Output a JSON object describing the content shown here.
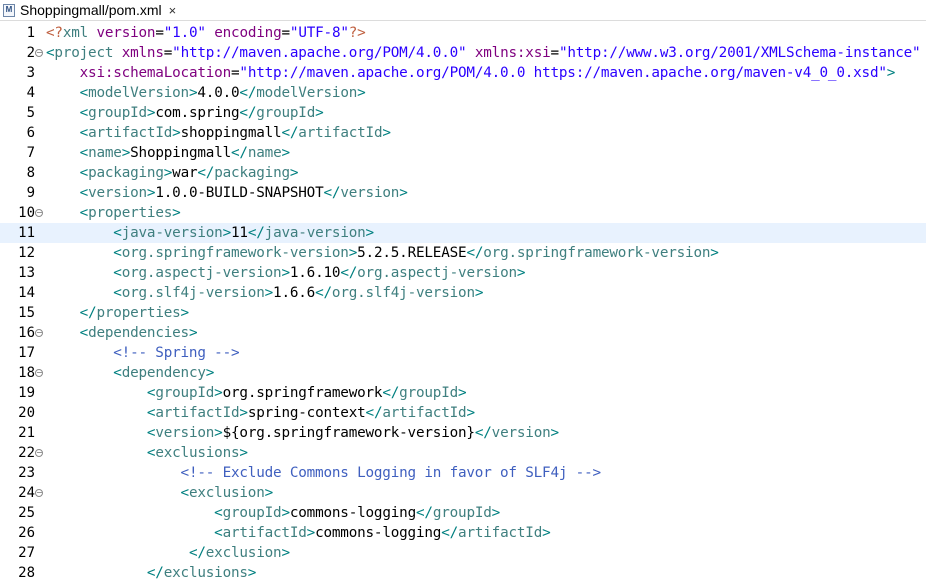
{
  "tab": {
    "title": "Shoppingmall/pom.xml",
    "icon": "M",
    "close": "×"
  },
  "editor": {
    "current_line": 11,
    "lines": [
      {
        "n": "1",
        "fold": false,
        "segs": [
          [
            "p",
            "<?"
          ],
          [
            "t",
            "xml "
          ],
          [
            "a",
            "version"
          ],
          [
            "x",
            "="
          ],
          [
            "v",
            "\"1.0\""
          ],
          [
            "x",
            " "
          ],
          [
            "a",
            "encoding"
          ],
          [
            "x",
            "="
          ],
          [
            "v",
            "\"UTF-8\""
          ],
          [
            "p",
            "?>"
          ]
        ]
      },
      {
        "n": "2",
        "fold": true,
        "segs": [
          [
            "b",
            "<"
          ],
          [
            "t",
            "project "
          ],
          [
            "a",
            "xmlns"
          ],
          [
            "x",
            "="
          ],
          [
            "v",
            "\"http://maven.apache.org/POM/4.0.0\""
          ],
          [
            "x",
            " "
          ],
          [
            "a",
            "xmlns:xsi"
          ],
          [
            "x",
            "="
          ],
          [
            "v",
            "\"http://www.w3.org/2001/XMLSchema-instance\""
          ]
        ]
      },
      {
        "n": "3",
        "fold": false,
        "segs": [
          [
            "x",
            "    "
          ],
          [
            "a",
            "xsi:schemaLocation"
          ],
          [
            "x",
            "="
          ],
          [
            "v",
            "\"http://maven.apache.org/POM/4.0.0 https://maven.apache.org/maven-v4_0_0.xsd\""
          ],
          [
            "b",
            ">"
          ]
        ]
      },
      {
        "n": "4",
        "fold": false,
        "segs": [
          [
            "x",
            "    "
          ],
          [
            "b",
            "<"
          ],
          [
            "t",
            "modelVersion"
          ],
          [
            "b",
            ">"
          ],
          [
            "x",
            "4.0.0"
          ],
          [
            "b",
            "</"
          ],
          [
            "t",
            "modelVersion"
          ],
          [
            "b",
            ">"
          ]
        ]
      },
      {
        "n": "5",
        "fold": false,
        "segs": [
          [
            "x",
            "    "
          ],
          [
            "b",
            "<"
          ],
          [
            "t",
            "groupId"
          ],
          [
            "b",
            ">"
          ],
          [
            "x",
            "com.spring"
          ],
          [
            "b",
            "</"
          ],
          [
            "t",
            "groupId"
          ],
          [
            "b",
            ">"
          ]
        ]
      },
      {
        "n": "6",
        "fold": false,
        "segs": [
          [
            "x",
            "    "
          ],
          [
            "b",
            "<"
          ],
          [
            "t",
            "artifactId"
          ],
          [
            "b",
            ">"
          ],
          [
            "x",
            "shoppingmall"
          ],
          [
            "b",
            "</"
          ],
          [
            "t",
            "artifactId"
          ],
          [
            "b",
            ">"
          ]
        ]
      },
      {
        "n": "7",
        "fold": false,
        "segs": [
          [
            "x",
            "    "
          ],
          [
            "b",
            "<"
          ],
          [
            "t",
            "name"
          ],
          [
            "b",
            ">"
          ],
          [
            "x",
            "Shoppingmall"
          ],
          [
            "b",
            "</"
          ],
          [
            "t",
            "name"
          ],
          [
            "b",
            ">"
          ]
        ]
      },
      {
        "n": "8",
        "fold": false,
        "segs": [
          [
            "x",
            "    "
          ],
          [
            "b",
            "<"
          ],
          [
            "t",
            "packaging"
          ],
          [
            "b",
            ">"
          ],
          [
            "x",
            "war"
          ],
          [
            "b",
            "</"
          ],
          [
            "t",
            "packaging"
          ],
          [
            "b",
            ">"
          ]
        ]
      },
      {
        "n": "9",
        "fold": false,
        "segs": [
          [
            "x",
            "    "
          ],
          [
            "b",
            "<"
          ],
          [
            "t",
            "version"
          ],
          [
            "b",
            ">"
          ],
          [
            "x",
            "1.0.0-BUILD-SNAPSHOT"
          ],
          [
            "b",
            "</"
          ],
          [
            "t",
            "version"
          ],
          [
            "b",
            ">"
          ]
        ]
      },
      {
        "n": "10",
        "fold": true,
        "segs": [
          [
            "x",
            "    "
          ],
          [
            "b",
            "<"
          ],
          [
            "t",
            "properties"
          ],
          [
            "b",
            ">"
          ]
        ]
      },
      {
        "n": "11",
        "fold": false,
        "segs": [
          [
            "x",
            "        "
          ],
          [
            "b",
            "<"
          ],
          [
            "t",
            "java-version"
          ],
          [
            "b",
            ">"
          ],
          [
            "x",
            "11"
          ],
          [
            "b",
            "</"
          ],
          [
            "t",
            "java-version"
          ],
          [
            "b",
            ">"
          ]
        ]
      },
      {
        "n": "12",
        "fold": false,
        "segs": [
          [
            "x",
            "        "
          ],
          [
            "b",
            "<"
          ],
          [
            "t",
            "org.springframework-version"
          ],
          [
            "b",
            ">"
          ],
          [
            "x",
            "5.2.5.RELEASE"
          ],
          [
            "b",
            "</"
          ],
          [
            "t",
            "org.springframework-version"
          ],
          [
            "b",
            ">"
          ]
        ]
      },
      {
        "n": "13",
        "fold": false,
        "segs": [
          [
            "x",
            "        "
          ],
          [
            "b",
            "<"
          ],
          [
            "t",
            "org.aspectj-version"
          ],
          [
            "b",
            ">"
          ],
          [
            "x",
            "1.6.10"
          ],
          [
            "b",
            "</"
          ],
          [
            "t",
            "org.aspectj-version"
          ],
          [
            "b",
            ">"
          ]
        ]
      },
      {
        "n": "14",
        "fold": false,
        "segs": [
          [
            "x",
            "        "
          ],
          [
            "b",
            "<"
          ],
          [
            "t",
            "org.slf4j-version"
          ],
          [
            "b",
            ">"
          ],
          [
            "x",
            "1.6.6"
          ],
          [
            "b",
            "</"
          ],
          [
            "t",
            "org.slf4j-version"
          ],
          [
            "b",
            ">"
          ]
        ]
      },
      {
        "n": "15",
        "fold": false,
        "segs": [
          [
            "x",
            "    "
          ],
          [
            "b",
            "</"
          ],
          [
            "t",
            "properties"
          ],
          [
            "b",
            ">"
          ]
        ]
      },
      {
        "n": "16",
        "fold": true,
        "segs": [
          [
            "x",
            "    "
          ],
          [
            "b",
            "<"
          ],
          [
            "t",
            "dependencies"
          ],
          [
            "b",
            ">"
          ]
        ]
      },
      {
        "n": "17",
        "fold": false,
        "segs": [
          [
            "x",
            "        "
          ],
          [
            "c",
            "<!-- Spring -->"
          ]
        ]
      },
      {
        "n": "18",
        "fold": true,
        "segs": [
          [
            "x",
            "        "
          ],
          [
            "b",
            "<"
          ],
          [
            "t",
            "dependency"
          ],
          [
            "b",
            ">"
          ]
        ]
      },
      {
        "n": "19",
        "fold": false,
        "segs": [
          [
            "x",
            "            "
          ],
          [
            "b",
            "<"
          ],
          [
            "t",
            "groupId"
          ],
          [
            "b",
            ">"
          ],
          [
            "x",
            "org.springframework"
          ],
          [
            "b",
            "</"
          ],
          [
            "t",
            "groupId"
          ],
          [
            "b",
            ">"
          ]
        ]
      },
      {
        "n": "20",
        "fold": false,
        "segs": [
          [
            "x",
            "            "
          ],
          [
            "b",
            "<"
          ],
          [
            "t",
            "artifactId"
          ],
          [
            "b",
            ">"
          ],
          [
            "x",
            "spring-context"
          ],
          [
            "b",
            "</"
          ],
          [
            "t",
            "artifactId"
          ],
          [
            "b",
            ">"
          ]
        ]
      },
      {
        "n": "21",
        "fold": false,
        "segs": [
          [
            "x",
            "            "
          ],
          [
            "b",
            "<"
          ],
          [
            "t",
            "version"
          ],
          [
            "b",
            ">"
          ],
          [
            "x",
            "${org.springframework-version}"
          ],
          [
            "b",
            "</"
          ],
          [
            "t",
            "version"
          ],
          [
            "b",
            ">"
          ]
        ]
      },
      {
        "n": "22",
        "fold": true,
        "segs": [
          [
            "x",
            "            "
          ],
          [
            "b",
            "<"
          ],
          [
            "t",
            "exclusions"
          ],
          [
            "b",
            ">"
          ]
        ]
      },
      {
        "n": "23",
        "fold": false,
        "segs": [
          [
            "x",
            "                "
          ],
          [
            "c",
            "<!-- Exclude Commons Logging in favor of SLF4j -->"
          ]
        ]
      },
      {
        "n": "24",
        "fold": true,
        "segs": [
          [
            "x",
            "                "
          ],
          [
            "b",
            "<"
          ],
          [
            "t",
            "exclusion"
          ],
          [
            "b",
            ">"
          ]
        ]
      },
      {
        "n": "25",
        "fold": false,
        "segs": [
          [
            "x",
            "                    "
          ],
          [
            "b",
            "<"
          ],
          [
            "t",
            "groupId"
          ],
          [
            "b",
            ">"
          ],
          [
            "x",
            "commons-logging"
          ],
          [
            "b",
            "</"
          ],
          [
            "t",
            "groupId"
          ],
          [
            "b",
            ">"
          ]
        ]
      },
      {
        "n": "26",
        "fold": false,
        "segs": [
          [
            "x",
            "                    "
          ],
          [
            "b",
            "<"
          ],
          [
            "t",
            "artifactId"
          ],
          [
            "b",
            ">"
          ],
          [
            "x",
            "commons-logging"
          ],
          [
            "b",
            "</"
          ],
          [
            "t",
            "artifactId"
          ],
          [
            "b",
            ">"
          ]
        ]
      },
      {
        "n": "27",
        "fold": false,
        "segs": [
          [
            "x",
            "                 "
          ],
          [
            "b",
            "</"
          ],
          [
            "t",
            "exclusion"
          ],
          [
            "b",
            ">"
          ]
        ]
      },
      {
        "n": "28",
        "fold": false,
        "segs": [
          [
            "x",
            "            "
          ],
          [
            "b",
            "</"
          ],
          [
            "t",
            "exclusions"
          ],
          [
            "b",
            ">"
          ]
        ]
      }
    ]
  }
}
